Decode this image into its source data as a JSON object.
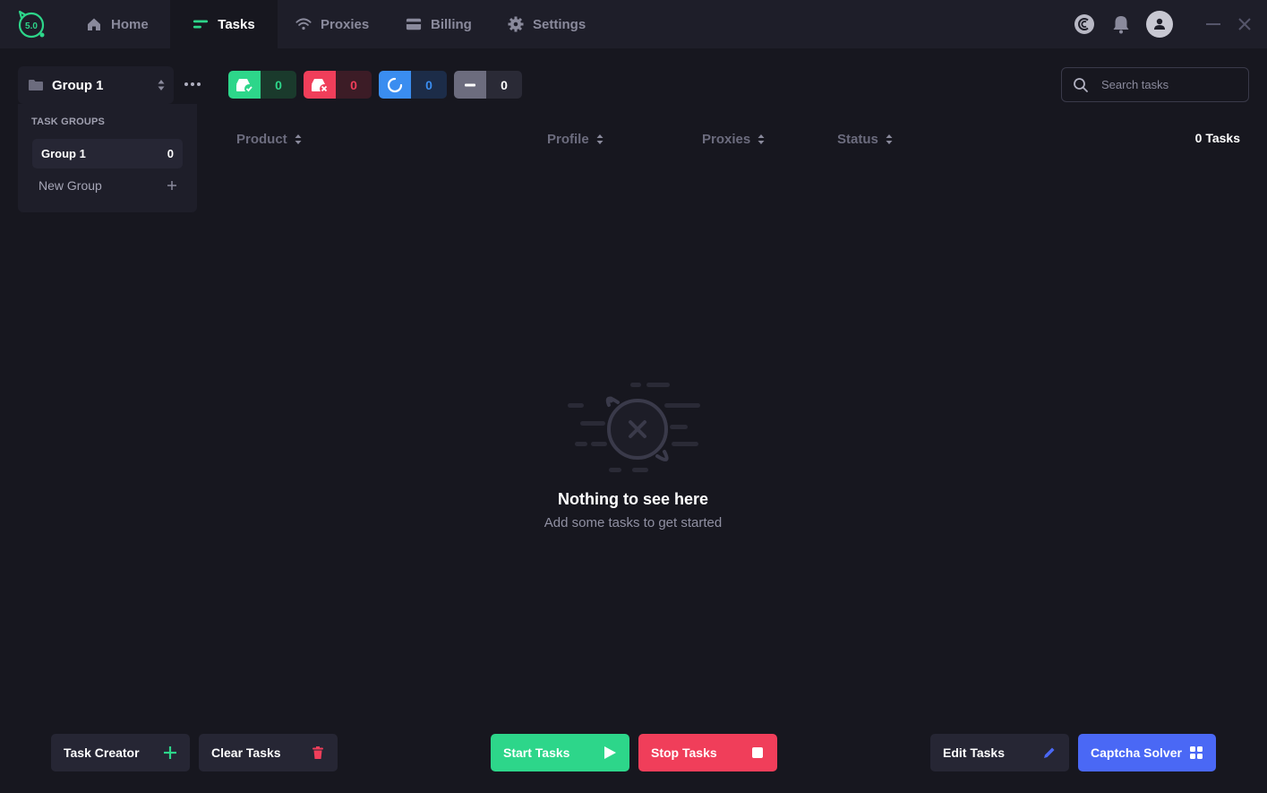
{
  "app": {
    "version_badge": "5.0",
    "colors": {
      "accent_green": "#2dd68a",
      "danger_red": "#f03e5a",
      "primary_blue": "#4a68f5",
      "info_blue": "#3a8df0"
    }
  },
  "nav": {
    "items": [
      {
        "label": "Home",
        "icon": "home-icon"
      },
      {
        "label": "Tasks",
        "icon": "tasks-icon",
        "active": true
      },
      {
        "label": "Proxies",
        "icon": "wifi-icon"
      },
      {
        "label": "Billing",
        "icon": "card-icon"
      },
      {
        "label": "Settings",
        "icon": "gear-icon"
      }
    ]
  },
  "topbar_icons": [
    "captcha-icon",
    "bell-icon",
    "avatar",
    "minimize-icon",
    "close-icon"
  ],
  "group_select": {
    "value": "Group 1"
  },
  "groups_panel": {
    "title": "TASK GROUPS",
    "groups": [
      {
        "name": "Group 1",
        "count": "0"
      }
    ],
    "new_group_label": "New Group"
  },
  "status_chips": [
    {
      "kind": "success",
      "count": "0"
    },
    {
      "kind": "failed",
      "count": "0"
    },
    {
      "kind": "running",
      "count": "0"
    },
    {
      "kind": "idle",
      "count": "0"
    }
  ],
  "search": {
    "placeholder": "Search tasks",
    "value": ""
  },
  "table": {
    "columns": [
      "Product",
      "Profile",
      "Proxies",
      "Status"
    ],
    "task_count_label": "0 Tasks"
  },
  "empty_state": {
    "title": "Nothing to see here",
    "subtitle": "Add some tasks to get started"
  },
  "buttons": {
    "task_creator": "Task Creator",
    "clear_tasks": "Clear Tasks",
    "start_tasks": "Start Tasks",
    "stop_tasks": "Stop Tasks",
    "edit_tasks": "Edit Tasks",
    "captcha_solver": "Captcha Solver"
  }
}
